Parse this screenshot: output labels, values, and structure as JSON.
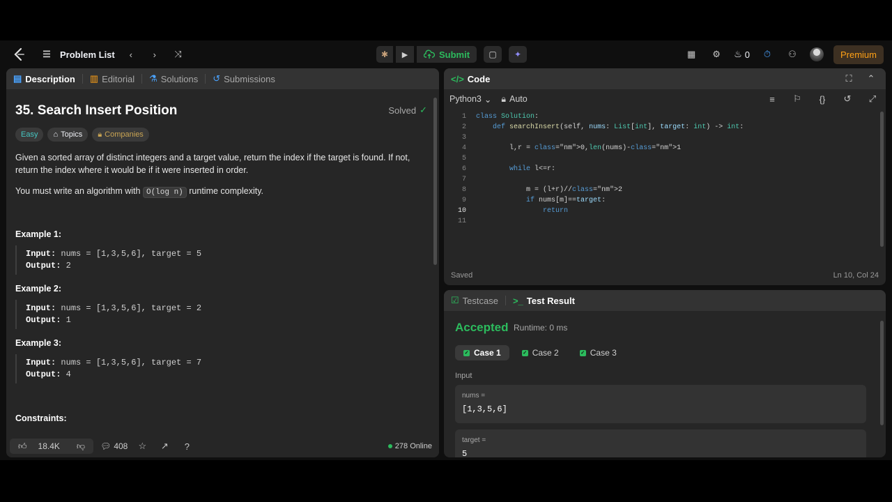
{
  "nav": {
    "problem_list": "Problem List",
    "submit": "Submit",
    "streak_count": "0",
    "premium": "Premium"
  },
  "desc_tabs": [
    "Description",
    "Editorial",
    "Solutions",
    "Submissions"
  ],
  "problem": {
    "title": "35. Search Insert Position",
    "solved": "Solved",
    "tags": [
      "Easy",
      "Topics",
      "Companies"
    ],
    "statement": "Given a sorted array of distinct integers and a target value, return the index if the target is found. If not, return the index where it would be if it were inserted in order.",
    "complexity_prefix": "You must write an algorithm with",
    "complexity_code": "O(log n)",
    "complexity_suffix": "runtime complexity.",
    "examples": [
      {
        "title": "Example 1:",
        "input_label": "Input:",
        "input": "nums = [1,3,5,6], target = 5",
        "output_label": "Output:",
        "output": "2"
      },
      {
        "title": "Example 2:",
        "input_label": "Input:",
        "input": "nums = [1,3,5,6], target = 2",
        "output_label": "Output:",
        "output": "1"
      },
      {
        "title": "Example 3:",
        "input_label": "Input:",
        "input": "nums = [1,3,5,6], target = 7",
        "output_label": "Output:",
        "output": "4"
      }
    ],
    "constraints": "Constraints:"
  },
  "desc_footer": {
    "likes": "18.4K",
    "comments": "408",
    "online": "278 Online"
  },
  "code_panel": {
    "title": "Code",
    "language": "Python3",
    "mode": "Auto",
    "status": "Saved",
    "cursor": "Ln 10, Col 24",
    "lines": [
      "class Solution:",
      "    def searchInsert(self, nums: List[int], target: int) -> int:",
      "",
      "        l,r = 0,len(nums)-1",
      "",
      "        while l<=r:",
      "",
      "            m = (l+r)//2",
      "            if nums[m]==target:",
      "                return",
      ""
    ]
  },
  "result_panel": {
    "tabs": [
      "Testcase",
      "Test Result"
    ],
    "verdict": "Accepted",
    "runtime": "Runtime: 0 ms",
    "cases": [
      "Case 1",
      "Case 2",
      "Case 3"
    ],
    "input_label": "Input",
    "inputs": [
      {
        "name": "nums =",
        "value": "[1,3,5,6]"
      },
      {
        "name": "target =",
        "value": "5"
      }
    ]
  }
}
